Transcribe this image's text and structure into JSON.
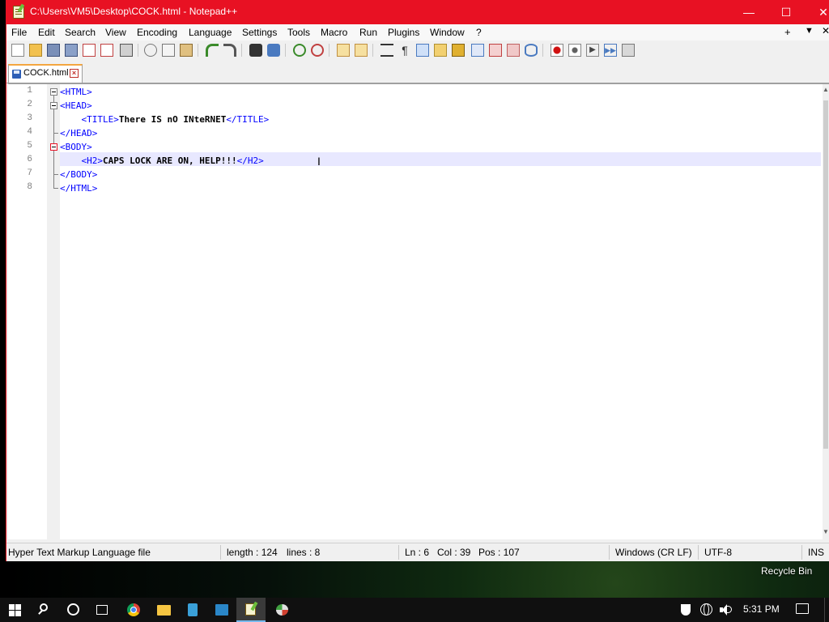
{
  "window": {
    "title": "C:\\Users\\VM5\\Desktop\\COCK.html - Notepad++",
    "minimize": "—",
    "maximize": "☐",
    "close": "✕"
  },
  "menubar": {
    "items": [
      "File",
      "Edit",
      "Search",
      "View",
      "Encoding",
      "Language",
      "Settings",
      "Tools",
      "Macro",
      "Run",
      "Plugins",
      "Window",
      "?"
    ],
    "extra_plus": "+",
    "extra_down": "▼",
    "extra_close": "✕"
  },
  "tab": {
    "label": "COCK.html",
    "close": "×"
  },
  "editor": {
    "line_numbers": [
      "1",
      "2",
      "3",
      "4",
      "5",
      "6",
      "7",
      "8"
    ],
    "lines": [
      {
        "indent": "",
        "open": "<HTML>",
        "text": "",
        "close": ""
      },
      {
        "indent": "",
        "open": "<HEAD>",
        "text": "",
        "close": ""
      },
      {
        "indent": "    ",
        "open": "<TITLE>",
        "text": "There IS nO INteRNET",
        "close": "</TITLE>"
      },
      {
        "indent": "",
        "open": "</HEAD>",
        "text": "",
        "close": ""
      },
      {
        "indent": "",
        "open": "<BODY>",
        "text": "",
        "close": ""
      },
      {
        "indent": "    ",
        "open": "<H2>",
        "text": "CAPS LOCK ARE ON, HELP!!!",
        "close": "</H2>"
      },
      {
        "indent": "",
        "open": "</BODY>",
        "text": "",
        "close": ""
      },
      {
        "indent": "",
        "open": "</HTML>",
        "text": "",
        "close": ""
      }
    ],
    "cursor_glyph": "I"
  },
  "statusbar": {
    "file_type": "Hyper Text Markup Language file",
    "length": "length : 124",
    "lines": "lines : 8",
    "ln": "Ln : 6",
    "col": "Col : 39",
    "pos": "Pos : 107",
    "eol": "Windows (CR LF)",
    "encoding": "UTF-8",
    "mode": "INS"
  },
  "desktop": {
    "recycle_bin_label": "Recycle Bin"
  },
  "taskbar": {
    "clock": "5:31 PM"
  },
  "colors": {
    "titlebar": "#e81123",
    "tag": "#0000ff",
    "current_line": "#e8e8ff"
  }
}
